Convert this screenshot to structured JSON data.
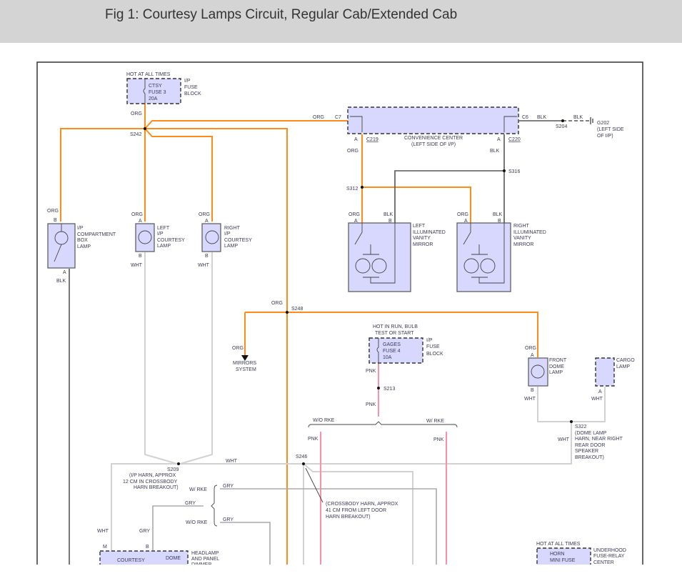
{
  "page": {
    "title": "Fig 1: Courtesy Lamps Circuit, Regular Cab/Extended Cab"
  },
  "colors": {
    "org": "#ff8c1a",
    "wht": "#d2d2d2",
    "blk": "#555555",
    "gry": "#aaaaaa",
    "pnk": "#ff8fa8",
    "component": "#d8d8ff"
  },
  "labels": {
    "hot_all_times": "HOT AT ALL TIMES",
    "ctsy_fuse": [
      "CTSY",
      "FUSE 3",
      "20A"
    ],
    "ip_fuse_block": [
      "I/P",
      "FUSE",
      "BLOCK"
    ],
    "org": "ORG",
    "blk": "BLK",
    "wht": "WHT",
    "gry": "GRY",
    "pnk": "PNK",
    "s242": "S242",
    "c7": "C7",
    "c6": "C6",
    "s204": "S204",
    "g202": [
      "G202",
      "(LEFT SIDE",
      "OF I/P)"
    ],
    "conv_center": [
      "CONVENIENCE CENTER",
      "(LEFT SIDE OF I/P)"
    ],
    "pin_a": "A",
    "pin_b": "B",
    "pin_m": "M",
    "c219": "C219",
    "c220": "C220",
    "s312": "S312",
    "s316": "S316",
    "ip_comp_lamp": [
      "I/P",
      "COMPARTMENT",
      "BOX",
      "LAMP"
    ],
    "left_courtesy": [
      "LEFT",
      "I/P",
      "COURTESY",
      "LAMP"
    ],
    "right_courtesy": [
      "RIGHT",
      "I/P",
      "COURTESY",
      "LAMP"
    ],
    "left_mirror": [
      "LEFT",
      "ILLUMINATED",
      "VANITY",
      "MIRROR"
    ],
    "right_mirror": [
      "RIGHT",
      "ILLUMINATED",
      "VANITY",
      "MIRROR"
    ],
    "s248": "S248",
    "mirrors_system": [
      "MIRRORS",
      "SYSTEM"
    ],
    "hot_run": [
      "HOT IN RUN, BULB",
      "TEST OR START"
    ],
    "gages_fuse": [
      "GAGES",
      "FUSE 4",
      "10A"
    ],
    "s213": "S213",
    "front_dome": [
      "FRONT",
      "DOME",
      "LAMP"
    ],
    "cargo_lamp": [
      "CARGO",
      "LAMP"
    ],
    "s322": [
      "S322",
      "(DOME LAMP",
      "HARN, NEAR RIGHT",
      "REAR DOOR",
      "SPEAKER",
      "BREAKOUT)"
    ],
    "wo_rke": "W/O RKE",
    "w_rke": "W/ RKE",
    "s209": [
      "S209",
      "(I/P HARN, APPROX",
      "12 CM IN CROSSBODY",
      "HARN BREAKOUT)"
    ],
    "s246": "S246",
    "s246_note": [
      "(CROSSBODY HARN, APPROX",
      "41 CM FROM LEFT DOOR",
      "HARN BREAKOUT)"
    ],
    "courtesy_lamps": "COURTESY",
    "dome_lamp": "DOME",
    "headlamp_dimmer": [
      "HEADLAMP",
      "AND PANEL",
      "DIMMER"
    ],
    "horn_fuse": [
      "HORN",
      "MINI FUSE"
    ],
    "underhood": [
      "UNDERHOOD",
      "FUSE-RELAY",
      "CENTER"
    ]
  }
}
